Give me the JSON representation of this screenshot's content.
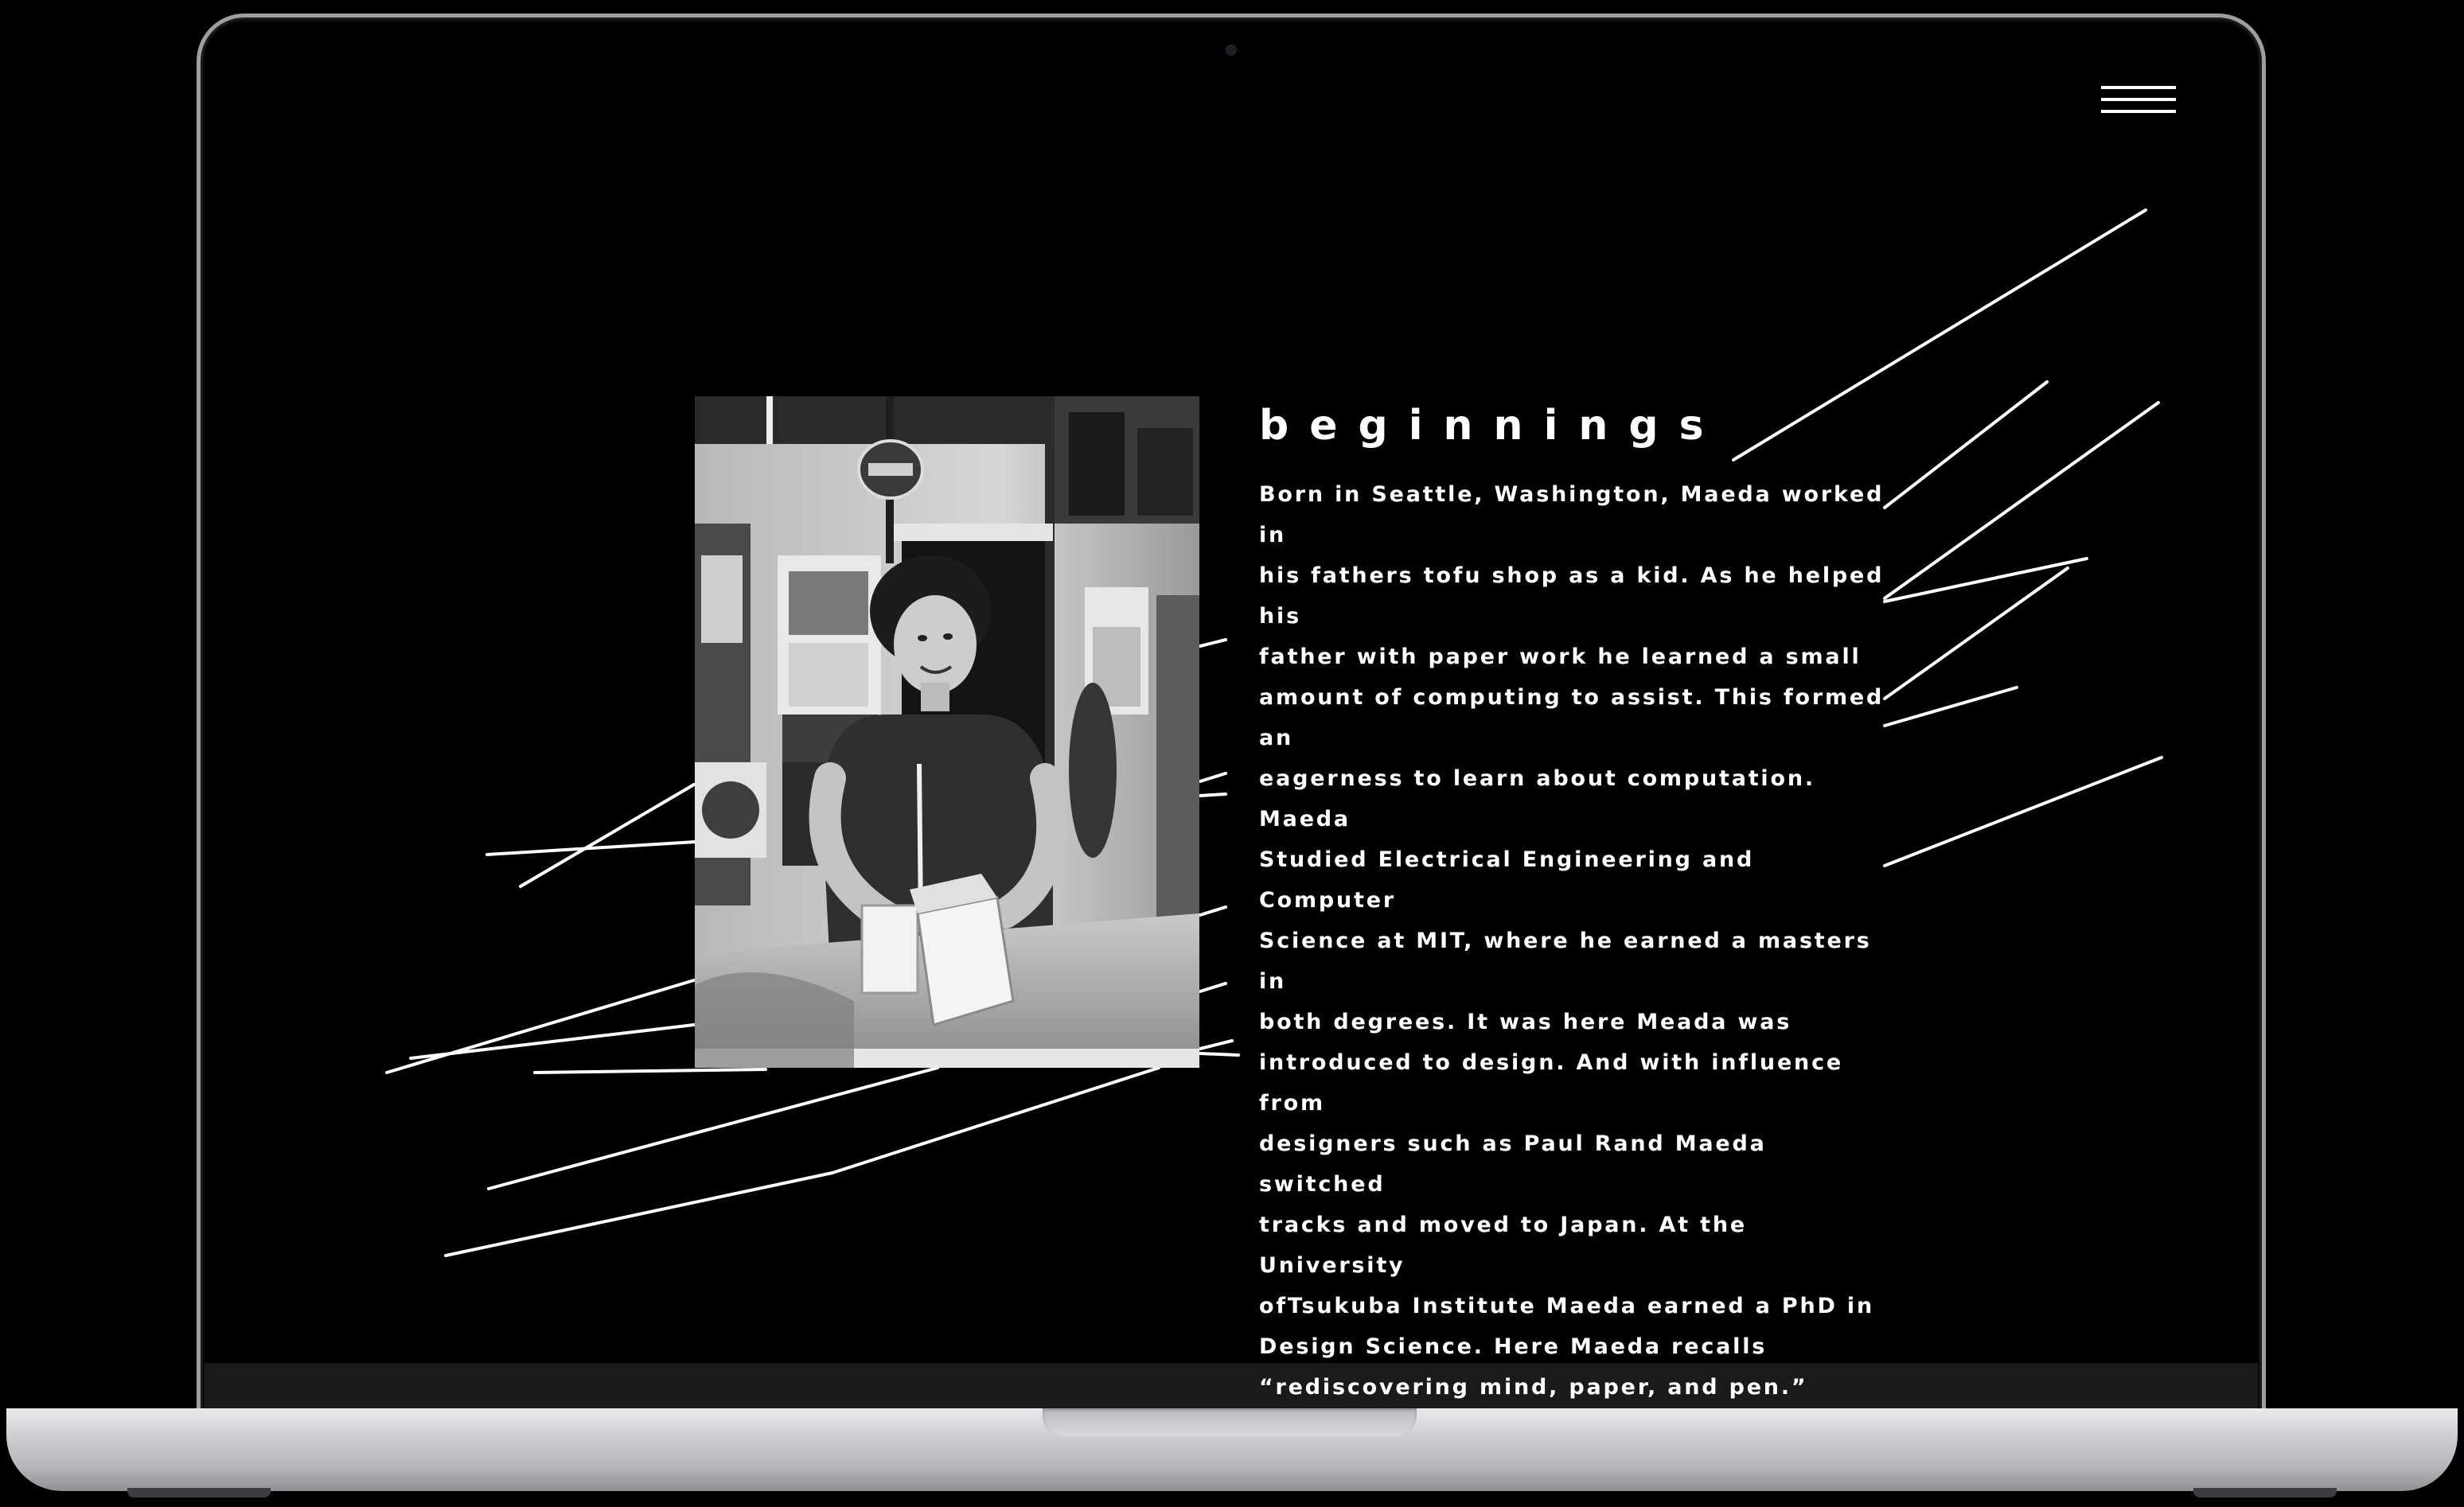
{
  "page": {
    "menu_icon": "hamburger-menu-icon",
    "heading": "beginnings",
    "body": "Born in Seattle, Washington, Maeda worked in\nhis fathers tofu shop as a kid. As he helped his\nfather with paper work he learned a small\namount of computing to assist. This formed an\neagerness to learn about computation. Maeda\nStudied Electrical Engineering and Computer\nScience at MIT, where he earned a masters in\nboth degrees. It was here Meada was\nintroduced to design. And with influence from\ndesigners such as Paul Rand Maeda switched\ntracks and moved to Japan. At the University\nofTsukuba Institute Maeda earned a PhD in\nDesign Science.  Here Maeda recalls\n“rediscovering mind, paper, and pen.”",
    "photo_alt": "Black and white photo of a smiling woman packing food containers in a tofu shop"
  },
  "colors": {
    "background": "#000000",
    "text": "#ffffff",
    "laptop_silver": "#c9cacd"
  }
}
